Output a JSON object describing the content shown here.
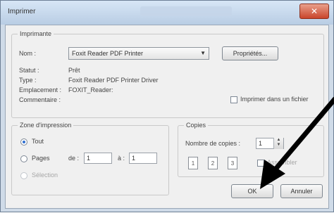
{
  "window": {
    "title": "Imprimer"
  },
  "printer_group": {
    "label": "Imprimante",
    "name_label": "Nom :",
    "name_value": "Foxit Reader PDF Printer",
    "properties_button": "Propriétés...",
    "status_label": "Statut :",
    "status_value": "Prêt",
    "type_label": "Type :",
    "type_value": "Foxit Reader PDF Printer Driver",
    "location_label": "Emplacement :",
    "location_value": "FOXIT_Reader:",
    "comment_label": "Commentaire :",
    "print_to_file_label": "Imprimer dans un fichier"
  },
  "range_group": {
    "label": "Zone d'impression",
    "all_label": "Tout",
    "pages_label": "Pages",
    "from_label": "de :",
    "from_value": "1",
    "to_label": "à :",
    "to_value": "1",
    "selection_label": "Sélection"
  },
  "copies_group": {
    "label": "Copies",
    "count_label": "Nombre de copies :",
    "count_value": "1",
    "collate_label": "Assembler",
    "page_icons": [
      "1",
      "2",
      "3"
    ]
  },
  "buttons": {
    "ok": "OK",
    "cancel": "Annuler"
  },
  "annotation": {
    "arrow_color": "#000000"
  }
}
